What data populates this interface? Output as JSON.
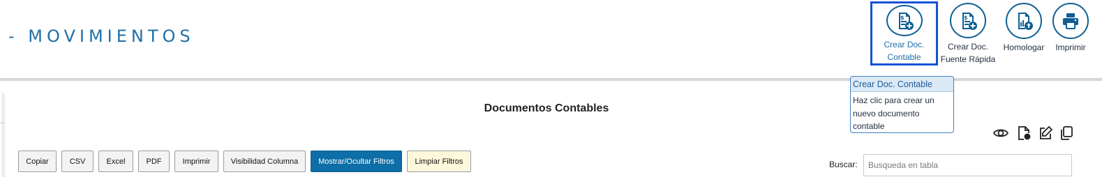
{
  "page": {
    "title": "- MOVIMIENTOS"
  },
  "toolbar": {
    "crear_doc_contable": {
      "line1": "Crear Doc.",
      "line2": "Contable",
      "icon": "document-dollar-plus-icon"
    },
    "crear_doc_fuente_rapida": {
      "line1": "Crear Doc.",
      "line2": "Fuente Rápida",
      "icon": "document-dollar-plus-icon"
    },
    "homologar": {
      "label": "Homologar",
      "icon": "document-chart-upload-icon"
    },
    "imprimir": {
      "label": "Imprimir",
      "icon": "printer-icon"
    },
    "accent_color": "#0f5f93",
    "active_border_color": "#1452d4"
  },
  "tooltip": {
    "title": "Crear Doc. Contable",
    "lines": [
      "Haz clic para crear un",
      "nuevo documento",
      "contable"
    ]
  },
  "section": {
    "title": "Documentos Contables"
  },
  "row_actions": [
    "eye-icon",
    "document-search-icon",
    "edit-icon",
    "copy-icon"
  ],
  "datatable": {
    "buttons": {
      "copiar": "Copiar",
      "csv": "CSV",
      "excel": "Excel",
      "pdf": "PDF",
      "imprimir": "Imprimir",
      "visibilidad": "Visibilidad Columna",
      "filtros": "Mostrar/Ocultar Filtros",
      "limpiar": "Limpiar Filtros"
    },
    "search": {
      "label": "Buscar:",
      "placeholder": "Busqueda en tabla",
      "value": ""
    },
    "primary_color": "#0e6ea7"
  }
}
